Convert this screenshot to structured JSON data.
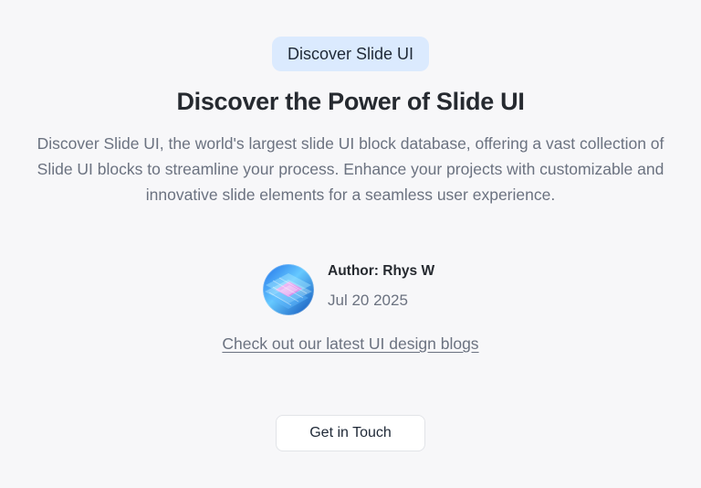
{
  "badge": {
    "label": "Discover Slide UI"
  },
  "hero": {
    "title": "Discover the Power of Slide UI",
    "description": "Discover Slide UI, the world's largest slide UI block database, offering a vast collection of Slide UI blocks to streamline your process. Enhance your projects with customizable and innovative slide elements for a seamless user experience."
  },
  "author": {
    "name": "Author: Rhys W",
    "date": "Jul 20 2025",
    "avatar_icon": "abstract-glass-layers-avatar"
  },
  "links": {
    "blogs": "Check out our latest UI design blogs"
  },
  "actions": {
    "cta_label": "Get in Touch"
  },
  "colors": {
    "background": "#f7f7f9",
    "badge_background": "#dbeafe",
    "heading": "#262a30",
    "muted_text": "#6b7280",
    "button_border": "#e2e4e8"
  }
}
